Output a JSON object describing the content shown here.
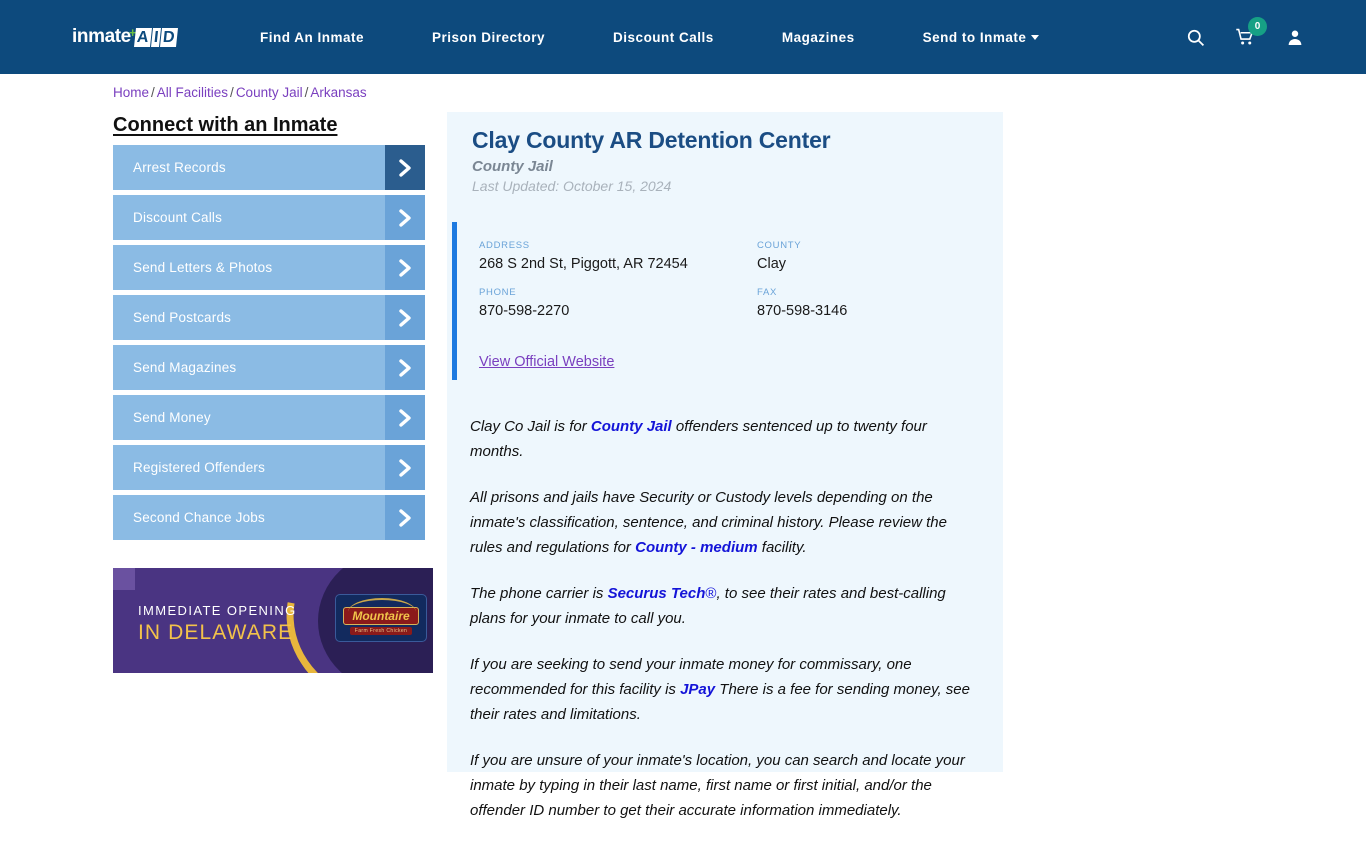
{
  "header": {
    "logo": {
      "word": "inmate",
      "plus": "+",
      "aid": [
        "A",
        "I",
        "D"
      ]
    },
    "nav": [
      {
        "label": "Find An Inmate"
      },
      {
        "label": "Prison Directory"
      },
      {
        "label": "Discount Calls"
      },
      {
        "label": "Magazines"
      },
      {
        "label": "Send to Inmate",
        "has_caret": true
      }
    ],
    "icons": {
      "search": "search-icon",
      "cart": "cart-icon",
      "cart_count": "0",
      "account": "user-icon"
    },
    "colors": {
      "bar": "#0d4a7d",
      "badge": "#16a085",
      "logo_plus": "#6cbf46"
    }
  },
  "breadcrumb": {
    "items": [
      "Home",
      "All Facilities",
      "County Jail",
      "Arkansas"
    ],
    "separator": "/"
  },
  "sidebar": {
    "title": "Connect with an Inmate",
    "items": [
      {
        "label": "Arrest Records",
        "active": true
      },
      {
        "label": "Discount Calls",
        "active": false
      },
      {
        "label": "Send Letters & Photos",
        "active": false
      },
      {
        "label": "Send Postcards",
        "active": false
      },
      {
        "label": "Send Magazines",
        "active": false
      },
      {
        "label": "Send Money",
        "active": false
      },
      {
        "label": "Registered Offenders",
        "active": false
      },
      {
        "label": "Second Chance Jobs",
        "active": false
      }
    ]
  },
  "ad": {
    "line1": "IMMEDIATE OPENING",
    "line2": "IN DELAWARE",
    "logo_name": "Mountaire",
    "logo_sub": "Farm Fresh Chicken",
    "colors": {
      "bg": "#4a3482",
      "accent": "#f3c24a"
    }
  },
  "facility": {
    "title": "Clay County AR Detention Center",
    "type": "County Jail",
    "last_updated": "Last Updated: October 15, 2024",
    "info": {
      "address_label": "ADDRESS",
      "address_value": "268 S 2nd St, Piggott, AR 72454",
      "county_label": "COUNTY",
      "county_value": "Clay",
      "phone_label": "PHONE",
      "phone_value": "870-598-2270",
      "fax_label": "FAX",
      "fax_value": "870-598-3146",
      "website_link": "View Official Website"
    },
    "paragraphs": {
      "p1_a": "Clay Co Jail is for ",
      "p1_b": "County Jail",
      "p1_c": " offenders sentenced up to twenty four months.",
      "p2_a": "All prisons and jails have Security or Custody levels depending on the inmate's classification, sentence, and criminal history. Please review the rules and regulations for ",
      "p2_b": "County - medium",
      "p2_c": " facility.",
      "p3_a": "The phone carrier is ",
      "p3_b": "Securus Tech",
      "p3_reg": "®",
      "p3_c": ", to see their rates and best-calling plans for your inmate to call you.",
      "p4_a": "If you are seeking to send your inmate money for commissary, one recommended for this facility is ",
      "p4_b": "JPay",
      "p4_c": " There is a fee for sending money, see their rates and limitations.",
      "p5_a": "If you are unsure of your inmate's location, you can search and locate your inmate by typing in their last name, first name or first initial, and/or the offender ID number to get their accurate information immediately."
    }
  }
}
